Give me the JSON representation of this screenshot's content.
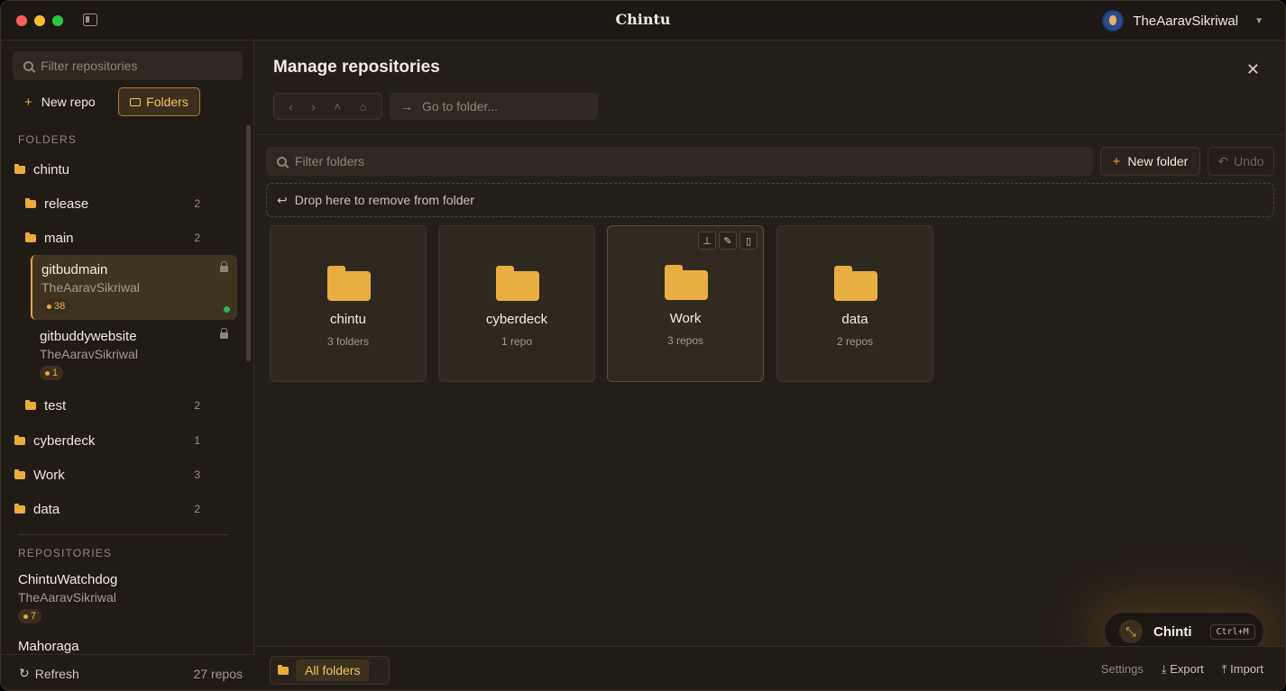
{
  "app": {
    "title": "Chintu"
  },
  "user": {
    "name": "TheAaravSikriwal"
  },
  "sidebar": {
    "filter_placeholder": "Filter repositories",
    "new_repo_label": "New repo",
    "folders_button_label": "Folders",
    "folders_section_label": "FOLDERS",
    "folders": [
      {
        "name": "chintu"
      },
      {
        "name": "release",
        "count": "2"
      },
      {
        "name": "main",
        "count": "2"
      },
      {
        "name": "test",
        "count": "2"
      },
      {
        "name": "cyberdeck",
        "count": "1"
      },
      {
        "name": "Work",
        "count": "3"
      },
      {
        "name": "data",
        "count": "2"
      }
    ],
    "nested_repos": [
      {
        "name": "gitbudmain",
        "owner": "TheAaravSikriwal",
        "badge": "38"
      },
      {
        "name": "gitbuddywebsite",
        "owner": "TheAaravSikriwal",
        "badge": "1"
      }
    ],
    "repositories_section_label": "REPOSITORIES",
    "repositories": [
      {
        "name": "ChintuWatchdog",
        "owner": "TheAaravSikriwal",
        "badge": "7"
      },
      {
        "name": "Mahoraga"
      }
    ],
    "refresh_label": "Refresh",
    "repo_total": "27 repos"
  },
  "main": {
    "title": "Manage repositories",
    "goto_placeholder": "Go to folder...",
    "filter_placeholder": "Filter folders",
    "new_folder_label": "New folder",
    "undo_label": "Undo",
    "dropzone_label": "Drop here to remove from folder",
    "tiles": [
      {
        "name": "chintu",
        "sub": "3 folders"
      },
      {
        "name": "cyberdeck",
        "sub": "1 repo"
      },
      {
        "name": "Work",
        "sub": "3 repos"
      },
      {
        "name": "data",
        "sub": "2 repos"
      }
    ],
    "all_folders_label": "All folders",
    "footer": {
      "settings": "Settings",
      "export": "Export",
      "import": "Import"
    }
  },
  "chinti": {
    "name": "Chinti",
    "shortcut": "Ctrl+M"
  },
  "colors": {
    "accent": "#e9ad3a",
    "background": "#241e18",
    "sidebar": "#211b16",
    "status_green": "#2fb552"
  }
}
